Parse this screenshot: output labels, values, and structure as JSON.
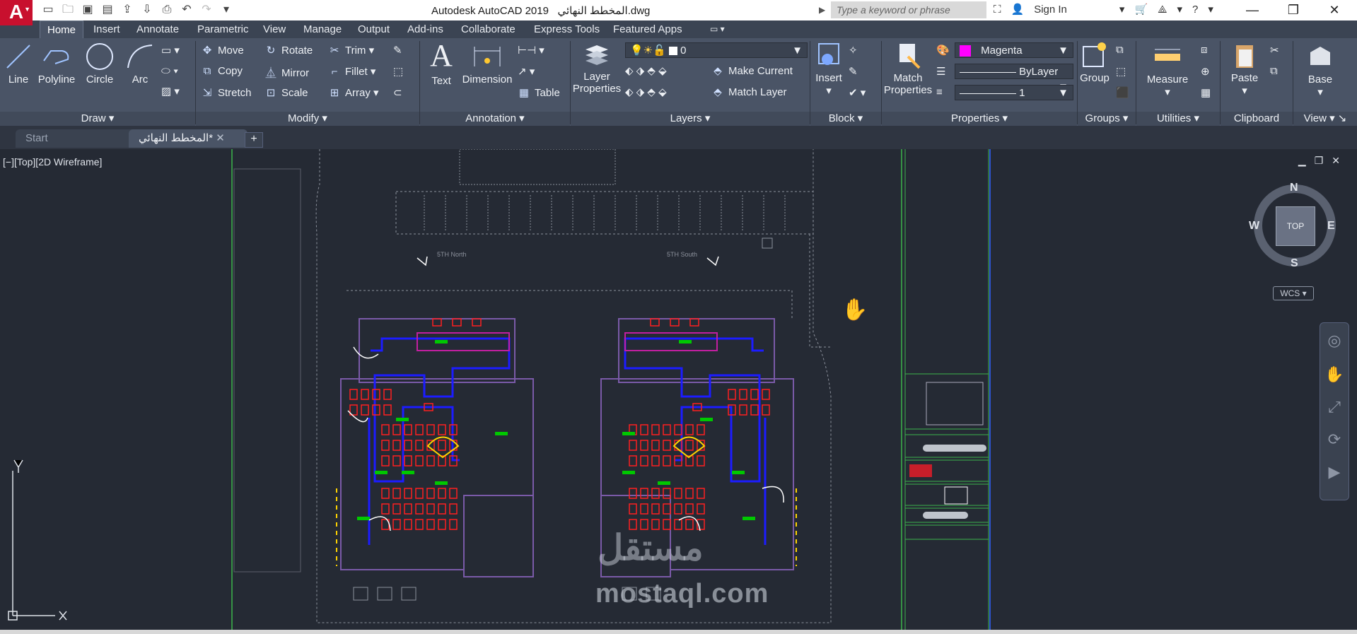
{
  "title_bar": {
    "app_title": "Autodesk AutoCAD 2019",
    "file_name": "المخطط النهائي.dwg",
    "search_placeholder": "Type a keyword or phrase",
    "sign_in": "Sign In",
    "logo_letter": "A"
  },
  "ribbon_tabs": [
    "Home",
    "Insert",
    "Annotate",
    "Parametric",
    "View",
    "Manage",
    "Output",
    "Add-ins",
    "Collaborate",
    "Express Tools",
    "Featured Apps"
  ],
  "draw": {
    "line": "Line",
    "polyline": "Polyline",
    "circle": "Circle",
    "arc": "Arc",
    "title": "Draw"
  },
  "modify": {
    "move": "Move",
    "rotate": "Rotate",
    "trim": "Trim",
    "copy": "Copy",
    "mirror": "Mirror",
    "fillet": "Fillet",
    "stretch": "Stretch",
    "scale": "Scale",
    "array": "Array",
    "title": "Modify"
  },
  "annotation": {
    "text": "Text",
    "dimension": "Dimension",
    "table": "Table",
    "title": "Annotation"
  },
  "layers": {
    "layer_properties_1": "Layer",
    "layer_properties_2": "Properties",
    "current_layer": "0",
    "make_current": "Make Current",
    "match_layer": "Match Layer",
    "title": "Layers"
  },
  "block": {
    "insert": "Insert",
    "title": "Block"
  },
  "properties": {
    "match_1": "Match",
    "match_2": "Properties",
    "color": "Magenta",
    "linetype": "ByLayer",
    "lineweight": "1",
    "title": "Properties",
    "color_hex": "#ff00ff"
  },
  "groups": {
    "group": "Group",
    "title": "Groups"
  },
  "utilities": {
    "measure": "Measure",
    "title": "Utilities"
  },
  "clipboard": {
    "paste": "Paste",
    "title": "Clipboard"
  },
  "view_panel": {
    "base": "Base",
    "title": "View"
  },
  "doc_tabs": {
    "start": "Start",
    "active": "المخطط النهائي*"
  },
  "viewport": {
    "label": "[−][Top][2D Wireframe]",
    "compass": {
      "n": "N",
      "s": "S",
      "e": "E",
      "w": "W",
      "top": "TOP",
      "wcs": "WCS"
    },
    "ucs": {
      "x": "X",
      "y": "Y"
    },
    "plan_labels": {
      "left": "5TH North",
      "right": "5TH South"
    }
  },
  "watermark": {
    "latin": "mostaql.com",
    "arabic": "مستقل"
  },
  "colors": {
    "ribbon": "#4a5466",
    "canvas": "#252a34",
    "walls": "#0000ff",
    "furniture": "#ff2020",
    "green": "#00c800",
    "accent": "#c8102e"
  }
}
